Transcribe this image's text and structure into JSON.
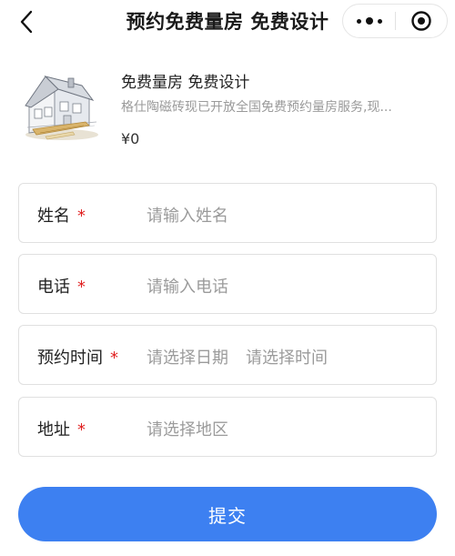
{
  "nav": {
    "title": "预约免费量房 免费设计",
    "back_icon": "chevron-left-icon",
    "more_icon": "more-dots-icon",
    "close_icon": "target-close-icon"
  },
  "product": {
    "image_icon": "house-sketch-image",
    "title": "免费量房 免费设计",
    "description": "格仕陶磁砖现已开放全国免费预约量房服务,现...",
    "price": "¥0"
  },
  "form": {
    "name": {
      "label": "姓名",
      "required": "*",
      "placeholder": "请输入姓名"
    },
    "phone": {
      "label": "电话",
      "required": "*",
      "placeholder": "请输入电话"
    },
    "time": {
      "label": "预约时间",
      "required": "*",
      "date_placeholder": "请选择日期",
      "time_placeholder": "请选择时间"
    },
    "address": {
      "label": "地址",
      "required": "*",
      "placeholder": "请选择地区"
    }
  },
  "submit": {
    "label": "提交"
  },
  "colors": {
    "accent": "#3d80f1",
    "required": "#e02020",
    "placeholder": "#9b9b9b"
  }
}
